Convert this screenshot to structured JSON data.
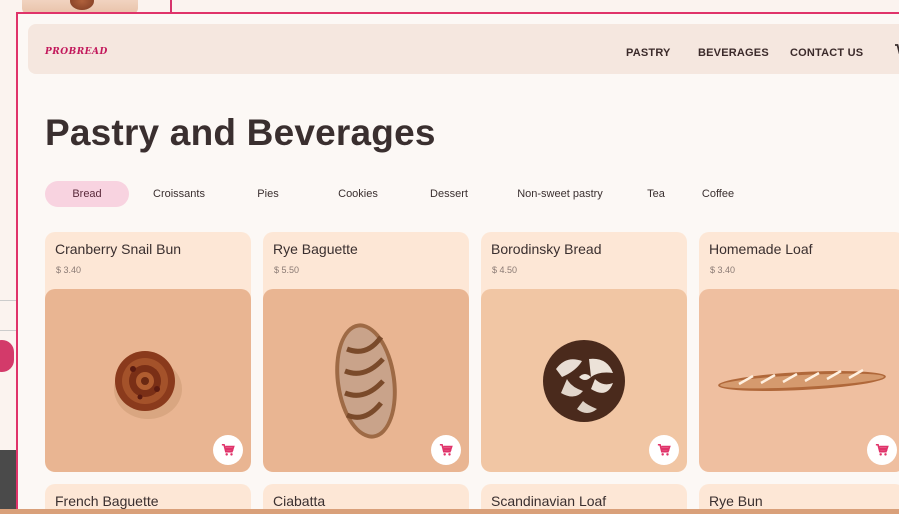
{
  "brand": {
    "logo": "PROBREAD"
  },
  "nav": {
    "links": [
      "PASTRY",
      "BEVERAGES",
      "CONTACT US"
    ]
  },
  "page": {
    "title": "Pastry and Beverages"
  },
  "categories": {
    "items": [
      "Bread",
      "Croissants",
      "Pies",
      "Cookies",
      "Dessert",
      "Non-sweet pastry",
      "Tea",
      "Coffee"
    ],
    "active": "Bread"
  },
  "products": [
    {
      "name": "Cranberry Snail Bun",
      "price": "$ 3.40",
      "icon": "snail-bun"
    },
    {
      "name": "Rye Baguette",
      "price": "$ 5.50",
      "icon": "rye-baguette"
    },
    {
      "name": "Borodinsky Bread",
      "price": "$ 4.50",
      "icon": "round-bread"
    },
    {
      "name": "Homemade Loaf",
      "price": "$ 3.40",
      "icon": "long-loaf"
    },
    {
      "name": "French Baguette"
    },
    {
      "name": "Ciabatta"
    },
    {
      "name": "Scandinavian Loaf"
    },
    {
      "name": "Rye Bun"
    }
  ],
  "colors": {
    "accent": "#e0336a",
    "card": "#fde7d6",
    "active_pill": "#f8d3e0",
    "image_bg": "#e9b592"
  }
}
